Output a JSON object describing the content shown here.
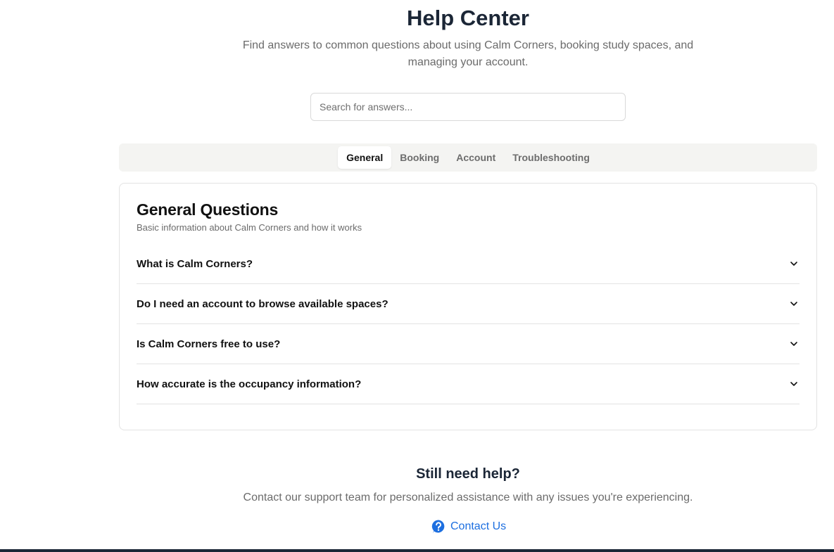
{
  "header": {
    "title": "Help Center",
    "subtitle": "Find answers to common questions about using Calm Corners, booking study spaces, and managing your account."
  },
  "search": {
    "placeholder": "Search for answers...",
    "value": ""
  },
  "tabs": [
    {
      "label": "General",
      "active": true
    },
    {
      "label": "Booking",
      "active": false
    },
    {
      "label": "Account",
      "active": false
    },
    {
      "label": "Troubleshooting",
      "active": false
    }
  ],
  "section": {
    "title": "General Questions",
    "description": "Basic information about Calm Corners and how it works",
    "faqs": [
      {
        "question": "What is Calm Corners?",
        "icon": "chevron-down-icon"
      },
      {
        "question": "Do I need an account to browse available spaces?",
        "icon": "chevron-down-icon"
      },
      {
        "question": "Is Calm Corners free to use?",
        "icon": "chevron-down-icon"
      },
      {
        "question": "How accurate is the occupancy information?",
        "icon": "chevron-down-icon"
      }
    ]
  },
  "help": {
    "title": "Still need help?",
    "description": "Contact our support team for personalized assistance with any issues you're experiencing.",
    "contact_label": "Contact Us",
    "contact_icon": "help-circle-icon"
  },
  "colors": {
    "accent": "#1d6fe0",
    "heading": "#1b2636",
    "tab_bar_bg": "#f4f4f2",
    "muted_text": "#6b6b6b"
  }
}
